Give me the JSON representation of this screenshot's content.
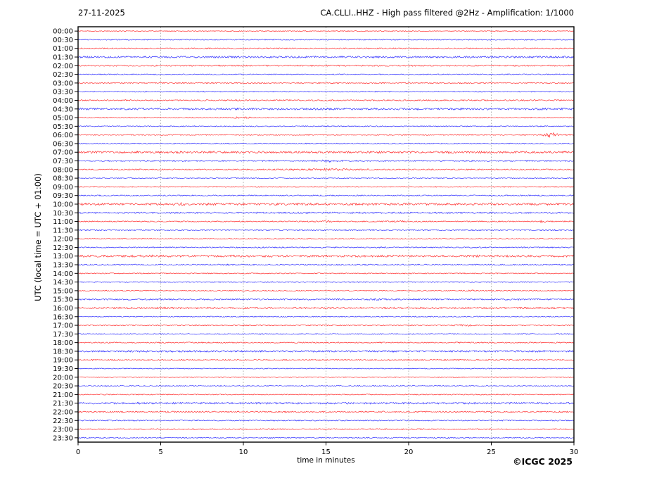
{
  "header": {
    "date": "27-11-2025",
    "title": "CA.CLLI..HHZ - High pass filtered @2Hz - Amplification: 1/1000"
  },
  "footer": {
    "copyright": "©ICGC 2025"
  },
  "chart_data": {
    "type": "line",
    "subtype": "helicorder-dayplot",
    "title": "CA.CLLI..HHZ - High pass filtered @2Hz - Amplification: 1/1000",
    "date": "27-11-2025",
    "xlabel": "time in minutes",
    "ylabel": "UTC (local time = UTC + 01:00)",
    "xlim": [
      0,
      30
    ],
    "x_ticks": [
      0,
      5,
      10,
      15,
      20,
      25,
      30
    ],
    "grid_minutes": [
      5,
      10,
      15,
      20,
      25
    ],
    "grid_on": true,
    "minutes_per_row": 30,
    "colors": {
      "hour_trace": "#ff0000",
      "half_hour_trace": "#0000ff",
      "grid": "#999999",
      "axis": "#000000"
    },
    "rows": [
      {
        "label": "00:00",
        "color": "#ff0000",
        "noise": 0.6,
        "events": []
      },
      {
        "label": "00:30",
        "color": "#0000ff",
        "noise": 0.7,
        "events": []
      },
      {
        "label": "01:00",
        "color": "#ff0000",
        "noise": 0.8,
        "events": []
      },
      {
        "label": "01:30",
        "color": "#0000ff",
        "noise": 1.3,
        "events": []
      },
      {
        "label": "02:00",
        "color": "#ff0000",
        "noise": 0.9,
        "events": []
      },
      {
        "label": "02:30",
        "color": "#0000ff",
        "noise": 0.7,
        "events": []
      },
      {
        "label": "03:00",
        "color": "#ff0000",
        "noise": 0.8,
        "events": []
      },
      {
        "label": "03:30",
        "color": "#0000ff",
        "noise": 0.7,
        "events": []
      },
      {
        "label": "04:00",
        "color": "#ff0000",
        "noise": 0.9,
        "events": []
      },
      {
        "label": "04:30",
        "color": "#0000ff",
        "noise": 1.4,
        "events": []
      },
      {
        "label": "05:00",
        "color": "#ff0000",
        "noise": 0.7,
        "events": [
          {
            "minute": 9.9,
            "amplitude": 0.9,
            "width_min": 0.3
          }
        ]
      },
      {
        "label": "05:30",
        "color": "#0000ff",
        "noise": 0.7,
        "events": []
      },
      {
        "label": "06:00",
        "color": "#ff0000",
        "noise": 0.7,
        "events": [
          {
            "minute": 28.6,
            "amplitude": 2.6,
            "width_min": 0.35
          }
        ]
      },
      {
        "label": "06:30",
        "color": "#0000ff",
        "noise": 0.7,
        "events": []
      },
      {
        "label": "07:00",
        "color": "#ff0000",
        "noise": 1.4,
        "events": []
      },
      {
        "label": "07:30",
        "color": "#0000ff",
        "noise": 0.9,
        "events": [
          {
            "minute": 15.4,
            "amplitude": 1.2,
            "width_min": 0.5
          }
        ]
      },
      {
        "label": "08:00",
        "color": "#ff0000",
        "noise": 0.9,
        "events": [
          {
            "minute": 15.0,
            "amplitude": 0.7,
            "width_min": 1.5
          }
        ]
      },
      {
        "label": "08:30",
        "color": "#0000ff",
        "noise": 0.6,
        "events": []
      },
      {
        "label": "09:00",
        "color": "#ff0000",
        "noise": 0.7,
        "events": []
      },
      {
        "label": "09:30",
        "color": "#0000ff",
        "noise": 0.8,
        "events": []
      },
      {
        "label": "10:00",
        "color": "#ff0000",
        "noise": 1.5,
        "events": [
          {
            "minute": 6.2,
            "amplitude": 0.8,
            "width_min": 0.2
          }
        ]
      },
      {
        "label": "10:30",
        "color": "#0000ff",
        "noise": 1.1,
        "events": []
      },
      {
        "label": "11:00",
        "color": "#ff0000",
        "noise": 0.8,
        "events": [
          {
            "minute": 15.1,
            "amplitude": 0.9,
            "width_min": 0.2
          },
          {
            "minute": 19.3,
            "amplitude": 0.7,
            "width_min": 0.3
          },
          {
            "minute": 28.1,
            "amplitude": 1.1,
            "width_min": 0.15
          }
        ]
      },
      {
        "label": "11:30",
        "color": "#0000ff",
        "noise": 0.9,
        "events": []
      },
      {
        "label": "12:00",
        "color": "#ff0000",
        "noise": 0.7,
        "events": []
      },
      {
        "label": "12:30",
        "color": "#0000ff",
        "noise": 0.8,
        "events": []
      },
      {
        "label": "13:00",
        "color": "#ff0000",
        "noise": 1.5,
        "events": []
      },
      {
        "label": "13:30",
        "color": "#0000ff",
        "noise": 0.9,
        "events": []
      },
      {
        "label": "14:00",
        "color": "#ff0000",
        "noise": 0.7,
        "events": []
      },
      {
        "label": "14:30",
        "color": "#0000ff",
        "noise": 0.7,
        "events": []
      },
      {
        "label": "15:00",
        "color": "#ff0000",
        "noise": 0.7,
        "events": [
          {
            "minute": 23.8,
            "amplitude": 0.9,
            "width_min": 0.12
          }
        ]
      },
      {
        "label": "15:30",
        "color": "#0000ff",
        "noise": 1.0,
        "events": [
          {
            "minute": 18.2,
            "amplitude": 0.7,
            "width_min": 0.25
          },
          {
            "minute": 26.4,
            "amplitude": 0.7,
            "width_min": 0.25
          }
        ]
      },
      {
        "label": "16:00",
        "color": "#ff0000",
        "noise": 1.2,
        "events": []
      },
      {
        "label": "16:30",
        "color": "#0000ff",
        "noise": 0.7,
        "events": []
      },
      {
        "label": "17:00",
        "color": "#ff0000",
        "noise": 0.7,
        "events": [
          {
            "minute": 23.3,
            "amplitude": 1.6,
            "width_min": 0.3
          }
        ]
      },
      {
        "label": "17:30",
        "color": "#0000ff",
        "noise": 0.7,
        "events": []
      },
      {
        "label": "18:00",
        "color": "#ff0000",
        "noise": 0.8,
        "events": []
      },
      {
        "label": "18:30",
        "color": "#0000ff",
        "noise": 1.2,
        "events": []
      },
      {
        "label": "19:00",
        "color": "#ff0000",
        "noise": 0.9,
        "events": []
      },
      {
        "label": "19:30",
        "color": "#0000ff",
        "noise": 0.6,
        "events": []
      },
      {
        "label": "20:00",
        "color": "#ff0000",
        "noise": 0.6,
        "events": []
      },
      {
        "label": "20:30",
        "color": "#0000ff",
        "noise": 0.7,
        "events": []
      },
      {
        "label": "21:00",
        "color": "#ff0000",
        "noise": 0.7,
        "events": []
      },
      {
        "label": "21:30",
        "color": "#0000ff",
        "noise": 1.3,
        "events": []
      },
      {
        "label": "22:00",
        "color": "#ff0000",
        "noise": 1.0,
        "events": []
      },
      {
        "label": "22:30",
        "color": "#0000ff",
        "noise": 0.8,
        "events": []
      },
      {
        "label": "23:00",
        "color": "#ff0000",
        "noise": 0.8,
        "events": []
      },
      {
        "label": "23:30",
        "color": "#0000ff",
        "noise": 0.7,
        "events": []
      }
    ]
  }
}
